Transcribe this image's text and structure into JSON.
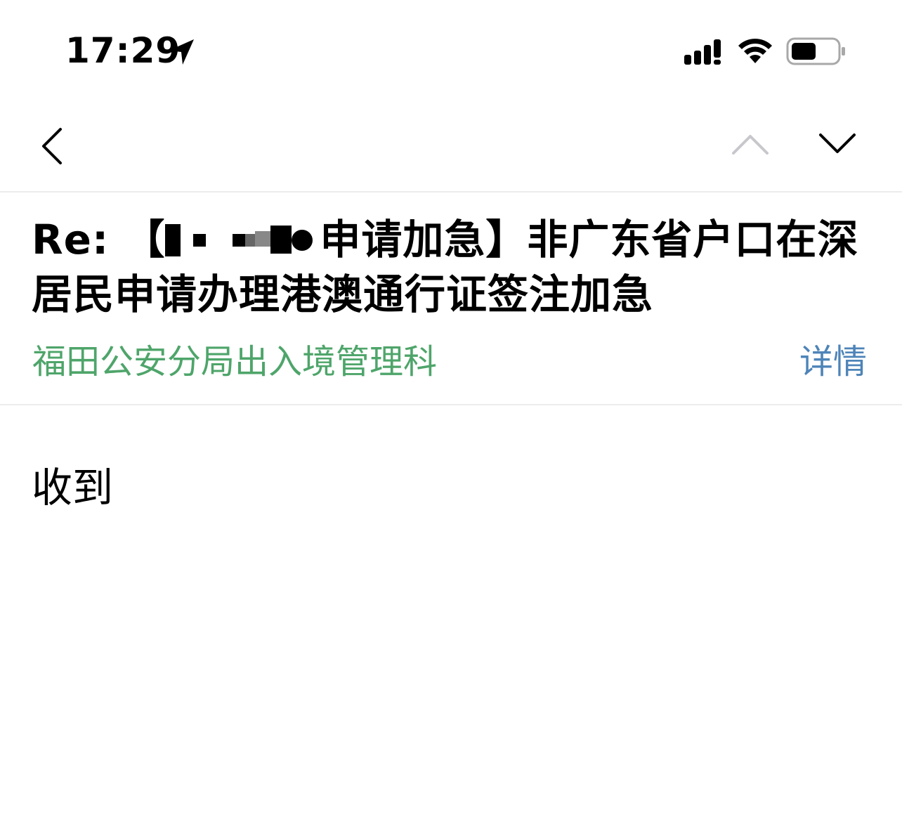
{
  "status_bar": {
    "time": "17:29"
  },
  "nav": {
    "back_icon": "chevron-left-icon",
    "prev_icon": "chevron-up-icon",
    "next_icon": "chevron-down-icon"
  },
  "email": {
    "subject_prefix": "Re: 【",
    "subject_rest": "申请加急】非广东省户口在深居民申请办理港澳通行证签注加急",
    "sender": "福田公安分局出入境管理科",
    "details_label": "详情",
    "body": "收到"
  },
  "colors": {
    "sender": "#4ea56a",
    "link": "#4e84b8",
    "divider": "#ececec",
    "disabled_icon": "#c7c7cc"
  }
}
